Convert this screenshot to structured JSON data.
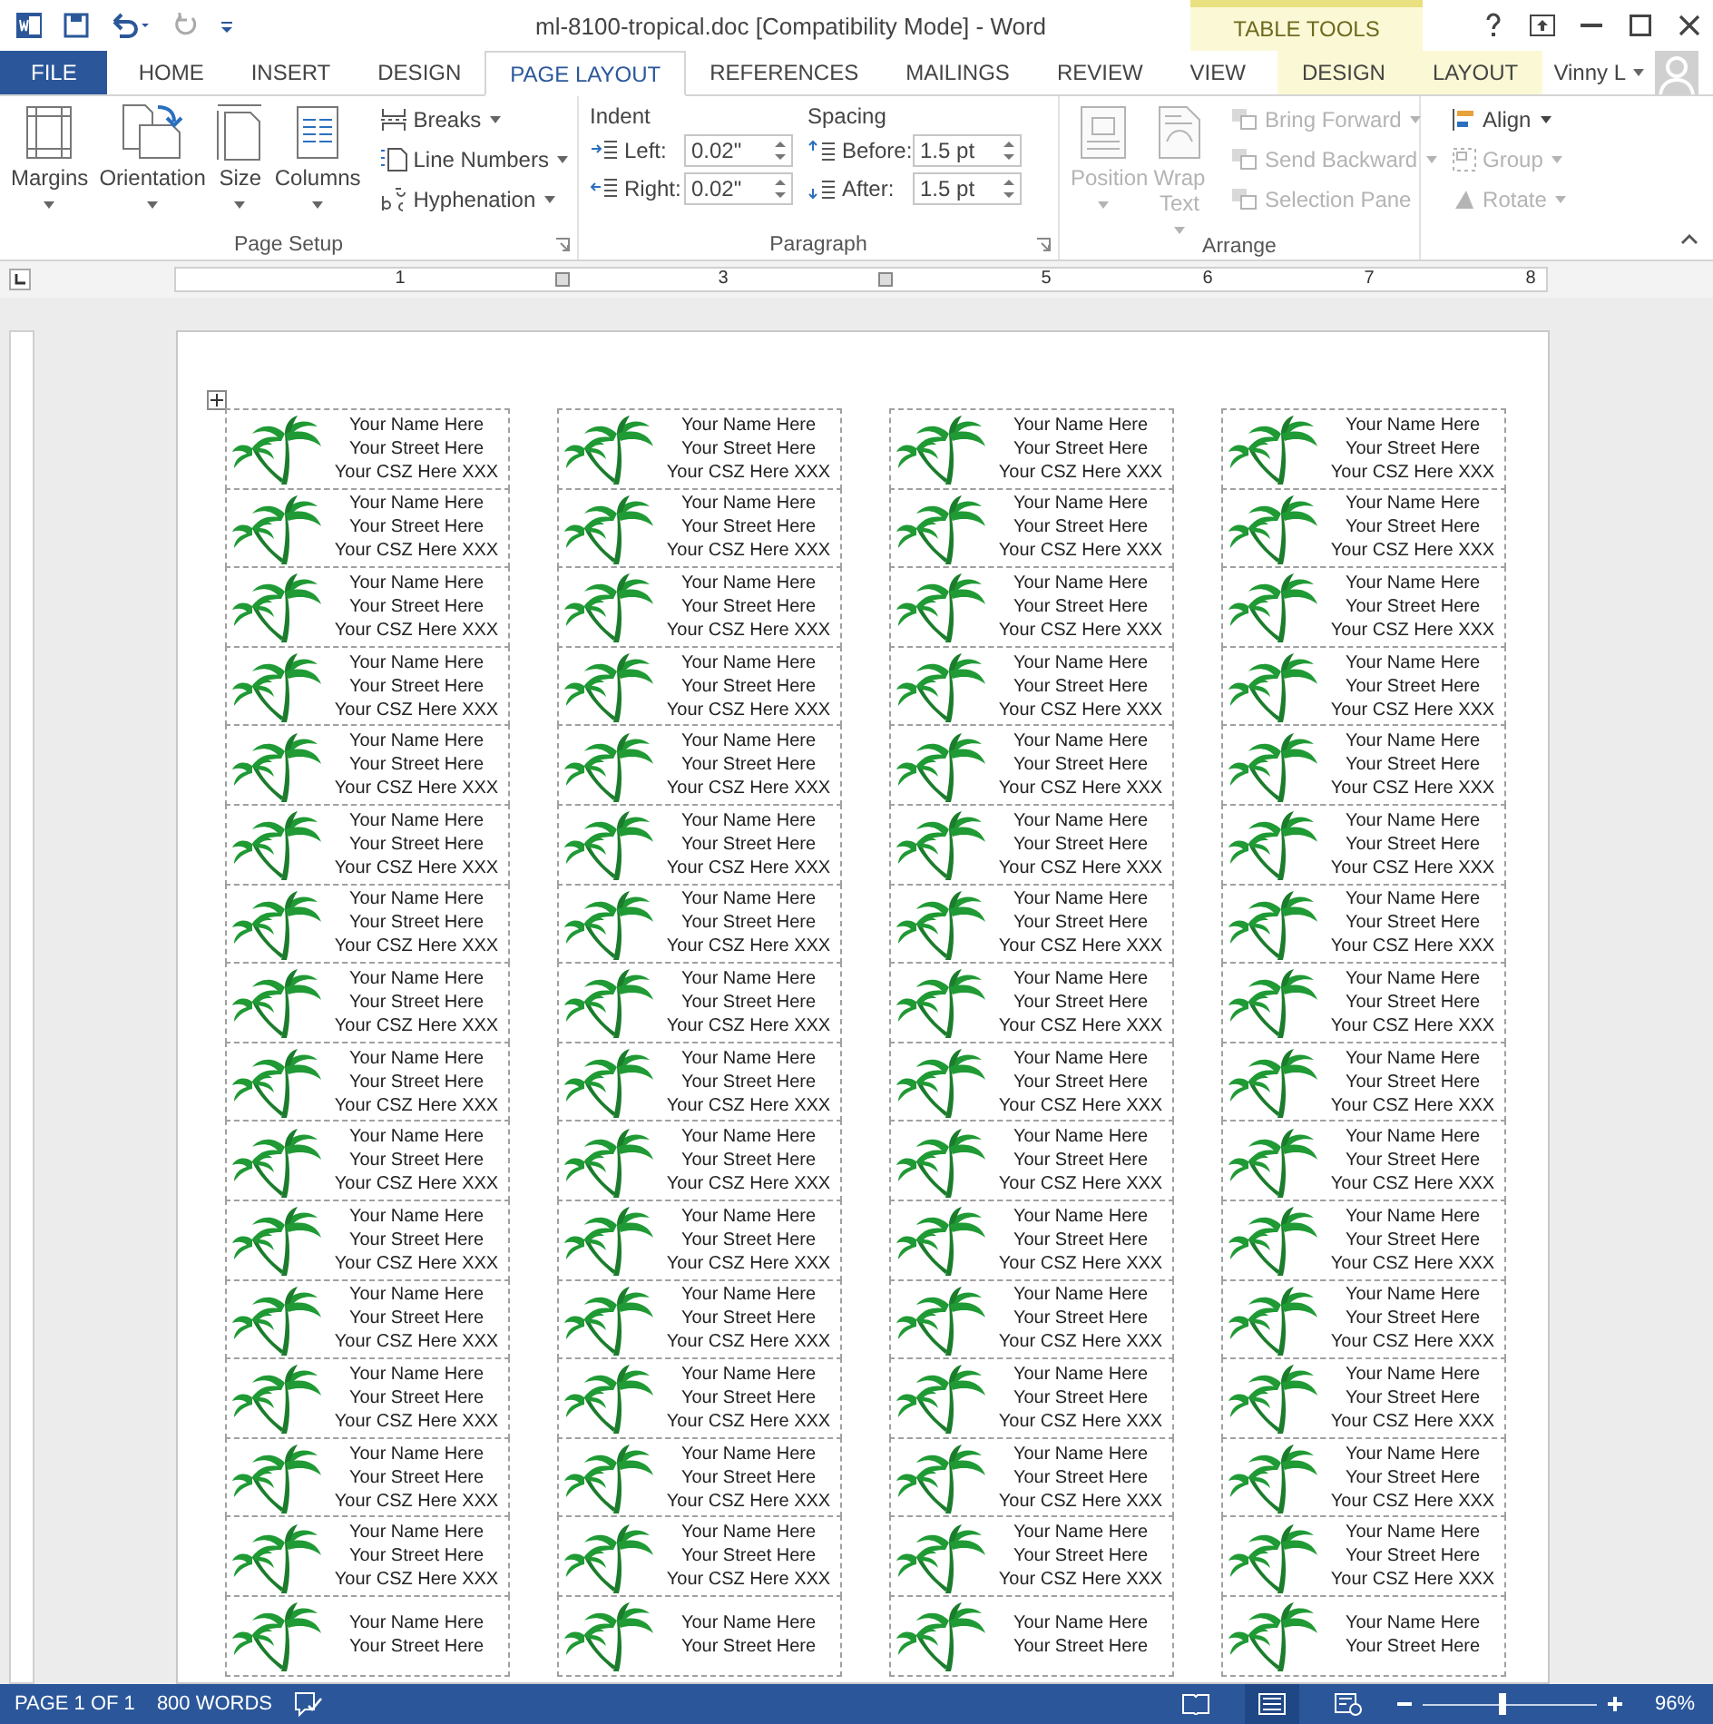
{
  "title_bar": {
    "title": "ml-8100-tropical.doc [Compatibility Mode] - Word",
    "quick_access": [
      {
        "kind": "save",
        "disabled": false
      },
      {
        "kind": "undo",
        "disabled": false
      },
      {
        "kind": "redo",
        "disabled": true
      },
      {
        "kind": "customize",
        "disabled": false
      }
    ],
    "contextual_header": "TABLE TOOLS"
  },
  "tabs": [
    {
      "label": "FILE",
      "kind": "file",
      "selected": false
    },
    {
      "label": "HOME",
      "kind": "tab",
      "selected": false
    },
    {
      "label": "INSERT",
      "kind": "tab",
      "selected": false
    },
    {
      "label": "DESIGN",
      "kind": "tab",
      "selected": false
    },
    {
      "label": "PAGE LAYOUT",
      "kind": "tab",
      "selected": true
    },
    {
      "label": "REFERENCES",
      "kind": "tab",
      "selected": false
    },
    {
      "label": "MAILINGS",
      "kind": "tab",
      "selected": false
    },
    {
      "label": "REVIEW",
      "kind": "tab",
      "selected": false
    },
    {
      "label": "VIEW",
      "kind": "tab",
      "selected": false
    },
    {
      "label": "DESIGN",
      "kind": "contextual",
      "selected": false
    },
    {
      "label": "LAYOUT",
      "kind": "contextual",
      "selected": false
    }
  ],
  "user": {
    "name": "Vinny L"
  },
  "ribbon": {
    "page_setup": {
      "title": "Page Setup",
      "large_buttons": [
        {
          "label": "Margins",
          "kind": "margins"
        },
        {
          "label": "Orientation",
          "kind": "orientation"
        },
        {
          "label": "Size",
          "kind": "size"
        },
        {
          "label": "Columns",
          "kind": "columns"
        }
      ],
      "small_buttons": [
        {
          "label": "Breaks",
          "kind": "breaks"
        },
        {
          "label": "Line Numbers",
          "kind": "line-numbers"
        },
        {
          "label": "Hyphenation",
          "kind": "hyphenation"
        }
      ]
    },
    "paragraph": {
      "title": "Paragraph",
      "sections": [
        {
          "heading": "Indent",
          "fields": [
            {
              "label": "Left:",
              "value": "0.02\"",
              "kind": "indent-left"
            },
            {
              "label": "Right:",
              "value": "0.02\"",
              "kind": "indent-right"
            }
          ]
        },
        {
          "heading": "Spacing",
          "fields": [
            {
              "label": "Before:",
              "value": "1.5 pt",
              "kind": "space-before"
            },
            {
              "label": "After:",
              "value": "1.5 pt",
              "kind": "space-after"
            }
          ]
        }
      ]
    },
    "arrange": {
      "title": "Arrange",
      "large_buttons": [
        {
          "label": "Position",
          "kind": "position",
          "disabled": true
        },
        {
          "label": "Wrap Text",
          "kind": "wrap",
          "disabled": true
        }
      ],
      "small_buttons": [
        {
          "label": "Bring Forward",
          "kind": "forward",
          "disabled": true
        },
        {
          "label": "Send Backward",
          "kind": "backward",
          "disabled": true
        },
        {
          "label": "Selection Pane",
          "kind": "pane",
          "disabled": true
        }
      ],
      "align_buttons": [
        {
          "label": "Align",
          "kind": "align",
          "disabled": false
        },
        {
          "label": "Group",
          "kind": "group",
          "disabled": true
        },
        {
          "label": "Rotate",
          "kind": "rotate",
          "disabled": true
        }
      ]
    }
  },
  "ruler": {
    "marks": [
      {
        "kind": "number",
        "label": "1"
      },
      {
        "kind": "column"
      },
      {
        "kind": "number",
        "label": "3"
      },
      {
        "kind": "column"
      },
      {
        "kind": "number",
        "label": "5"
      },
      {
        "kind": "number",
        "label": "6"
      },
      {
        "kind": "number",
        "label": "7"
      },
      {
        "kind": "number",
        "label": "8"
      }
    ]
  },
  "label_rows": [
    {
      "labels": [
        {
          "lines": [
            "Your Name Here",
            "Your Street Here",
            "Your CSZ Here XXX"
          ]
        },
        {
          "lines": [
            "Your Name Here",
            "Your Street Here",
            "Your CSZ Here XXX"
          ]
        },
        {
          "lines": [
            "Your Name Here",
            "Your Street Here",
            "Your CSZ Here XXX"
          ]
        },
        {
          "lines": [
            "Your Name Here",
            "Your Street Here",
            "Your CSZ Here XXX"
          ]
        }
      ]
    },
    {
      "labels": [
        {
          "lines": [
            "Your Name Here",
            "Your Street Here",
            "Your CSZ Here XXX"
          ]
        },
        {
          "lines": [
            "Your Name Here",
            "Your Street Here",
            "Your CSZ Here XXX"
          ]
        },
        {
          "lines": [
            "Your Name Here",
            "Your Street Here",
            "Your CSZ Here XXX"
          ]
        },
        {
          "lines": [
            "Your Name Here",
            "Your Street Here",
            "Your CSZ Here XXX"
          ]
        }
      ]
    },
    {
      "labels": [
        {
          "lines": [
            "Your Name Here",
            "Your Street Here",
            "Your CSZ Here XXX"
          ]
        },
        {
          "lines": [
            "Your Name Here",
            "Your Street Here",
            "Your CSZ Here XXX"
          ]
        },
        {
          "lines": [
            "Your Name Here",
            "Your Street Here",
            "Your CSZ Here XXX"
          ]
        },
        {
          "lines": [
            "Your Name Here",
            "Your Street Here",
            "Your CSZ Here XXX"
          ]
        }
      ]
    },
    {
      "labels": [
        {
          "lines": [
            "Your Name Here",
            "Your Street Here",
            "Your CSZ Here XXX"
          ]
        },
        {
          "lines": [
            "Your Name Here",
            "Your Street Here",
            "Your CSZ Here XXX"
          ]
        },
        {
          "lines": [
            "Your Name Here",
            "Your Street Here",
            "Your CSZ Here XXX"
          ]
        },
        {
          "lines": [
            "Your Name Here",
            "Your Street Here",
            "Your CSZ Here XXX"
          ]
        }
      ]
    },
    {
      "labels": [
        {
          "lines": [
            "Your Name Here",
            "Your Street Here",
            "Your CSZ Here XXX"
          ]
        },
        {
          "lines": [
            "Your Name Here",
            "Your Street Here",
            "Your CSZ Here XXX"
          ]
        },
        {
          "lines": [
            "Your Name Here",
            "Your Street Here",
            "Your CSZ Here XXX"
          ]
        },
        {
          "lines": [
            "Your Name Here",
            "Your Street Here",
            "Your CSZ Here XXX"
          ]
        }
      ]
    },
    {
      "labels": [
        {
          "lines": [
            "Your Name Here",
            "Your Street Here",
            "Your CSZ Here XXX"
          ]
        },
        {
          "lines": [
            "Your Name Here",
            "Your Street Here",
            "Your CSZ Here XXX"
          ]
        },
        {
          "lines": [
            "Your Name Here",
            "Your Street Here",
            "Your CSZ Here XXX"
          ]
        },
        {
          "lines": [
            "Your Name Here",
            "Your Street Here",
            "Your CSZ Here XXX"
          ]
        }
      ]
    },
    {
      "labels": [
        {
          "lines": [
            "Your Name Here",
            "Your Street Here",
            "Your CSZ Here XXX"
          ]
        },
        {
          "lines": [
            "Your Name Here",
            "Your Street Here",
            "Your CSZ Here XXX"
          ]
        },
        {
          "lines": [
            "Your Name Here",
            "Your Street Here",
            "Your CSZ Here XXX"
          ]
        },
        {
          "lines": [
            "Your Name Here",
            "Your Street Here",
            "Your CSZ Here XXX"
          ]
        }
      ]
    },
    {
      "labels": [
        {
          "lines": [
            "Your Name Here",
            "Your Street Here",
            "Your CSZ Here XXX"
          ]
        },
        {
          "lines": [
            "Your Name Here",
            "Your Street Here",
            "Your CSZ Here XXX"
          ]
        },
        {
          "lines": [
            "Your Name Here",
            "Your Street Here",
            "Your CSZ Here XXX"
          ]
        },
        {
          "lines": [
            "Your Name Here",
            "Your Street Here",
            "Your CSZ Here XXX"
          ]
        }
      ]
    },
    {
      "labels": [
        {
          "lines": [
            "Your Name Here",
            "Your Street Here",
            "Your CSZ Here XXX"
          ]
        },
        {
          "lines": [
            "Your Name Here",
            "Your Street Here",
            "Your CSZ Here XXX"
          ]
        },
        {
          "lines": [
            "Your Name Here",
            "Your Street Here",
            "Your CSZ Here XXX"
          ]
        },
        {
          "lines": [
            "Your Name Here",
            "Your Street Here",
            "Your CSZ Here XXX"
          ]
        }
      ]
    },
    {
      "labels": [
        {
          "lines": [
            "Your Name Here",
            "Your Street Here",
            "Your CSZ Here XXX"
          ]
        },
        {
          "lines": [
            "Your Name Here",
            "Your Street Here",
            "Your CSZ Here XXX"
          ]
        },
        {
          "lines": [
            "Your Name Here",
            "Your Street Here",
            "Your CSZ Here XXX"
          ]
        },
        {
          "lines": [
            "Your Name Here",
            "Your Street Here",
            "Your CSZ Here XXX"
          ]
        }
      ]
    },
    {
      "labels": [
        {
          "lines": [
            "Your Name Here",
            "Your Street Here",
            "Your CSZ Here XXX"
          ]
        },
        {
          "lines": [
            "Your Name Here",
            "Your Street Here",
            "Your CSZ Here XXX"
          ]
        },
        {
          "lines": [
            "Your Name Here",
            "Your Street Here",
            "Your CSZ Here XXX"
          ]
        },
        {
          "lines": [
            "Your Name Here",
            "Your Street Here",
            "Your CSZ Here XXX"
          ]
        }
      ]
    },
    {
      "labels": [
        {
          "lines": [
            "Your Name Here",
            "Your Street Here",
            "Your CSZ Here XXX"
          ]
        },
        {
          "lines": [
            "Your Name Here",
            "Your Street Here",
            "Your CSZ Here XXX"
          ]
        },
        {
          "lines": [
            "Your Name Here",
            "Your Street Here",
            "Your CSZ Here XXX"
          ]
        },
        {
          "lines": [
            "Your Name Here",
            "Your Street Here",
            "Your CSZ Here XXX"
          ]
        }
      ]
    },
    {
      "labels": [
        {
          "lines": [
            "Your Name Here",
            "Your Street Here",
            "Your CSZ Here XXX"
          ]
        },
        {
          "lines": [
            "Your Name Here",
            "Your Street Here",
            "Your CSZ Here XXX"
          ]
        },
        {
          "lines": [
            "Your Name Here",
            "Your Street Here",
            "Your CSZ Here XXX"
          ]
        },
        {
          "lines": [
            "Your Name Here",
            "Your Street Here",
            "Your CSZ Here XXX"
          ]
        }
      ]
    },
    {
      "labels": [
        {
          "lines": [
            "Your Name Here",
            "Your Street Here",
            "Your CSZ Here XXX"
          ]
        },
        {
          "lines": [
            "Your Name Here",
            "Your Street Here",
            "Your CSZ Here XXX"
          ]
        },
        {
          "lines": [
            "Your Name Here",
            "Your Street Here",
            "Your CSZ Here XXX"
          ]
        },
        {
          "lines": [
            "Your Name Here",
            "Your Street Here",
            "Your CSZ Here XXX"
          ]
        }
      ]
    },
    {
      "labels": [
        {
          "lines": [
            "Your Name Here",
            "Your Street Here",
            "Your CSZ Here XXX"
          ]
        },
        {
          "lines": [
            "Your Name Here",
            "Your Street Here",
            "Your CSZ Here XXX"
          ]
        },
        {
          "lines": [
            "Your Name Here",
            "Your Street Here",
            "Your CSZ Here XXX"
          ]
        },
        {
          "lines": [
            "Your Name Here",
            "Your Street Here",
            "Your CSZ Here XXX"
          ]
        }
      ]
    },
    {
      "labels": [
        {
          "lines": [
            "Your Name Here",
            "Your Street Here"
          ]
        },
        {
          "lines": [
            "Your Name Here",
            "Your Street Here"
          ]
        },
        {
          "lines": [
            "Your Name Here",
            "Your Street Here"
          ]
        },
        {
          "lines": [
            "Your Name Here",
            "Your Street Here"
          ]
        }
      ]
    }
  ],
  "status_bar": {
    "page": "PAGE 1 OF 1",
    "words": "800 WORDS",
    "views": [
      {
        "kind": "read",
        "selected": false
      },
      {
        "kind": "print",
        "selected": true
      },
      {
        "kind": "web",
        "selected": false
      }
    ],
    "zoom": {
      "level": 0.46,
      "reading": "96%"
    }
  }
}
